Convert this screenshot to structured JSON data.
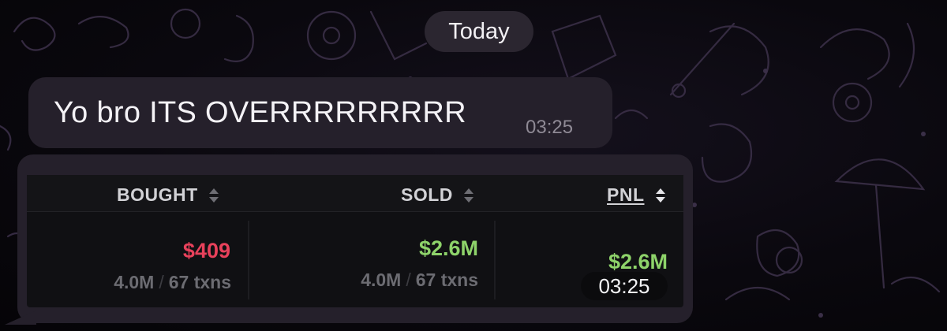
{
  "chat": {
    "date_label": "Today",
    "message": {
      "text": "Yo bro ITS OVERRRRRRRRR",
      "time": "03:25"
    },
    "media_time": "03:25"
  },
  "table": {
    "columns": [
      {
        "label": "BOUGHT",
        "active": false
      },
      {
        "label": "SOLD",
        "active": false
      },
      {
        "label": "PNL",
        "active": true
      }
    ],
    "row": {
      "bought": {
        "value": "$409",
        "amount": "4.0M",
        "txns": "67 txns"
      },
      "sold": {
        "value": "$2.6M",
        "amount": "4.0M",
        "txns": "67 txns"
      },
      "pnl": {
        "value": "$2.6M"
      }
    }
  },
  "colors": {
    "negative": "#e8415b",
    "positive": "#8ed36a",
    "bubble": "#25202b",
    "background": "#0a080e"
  }
}
